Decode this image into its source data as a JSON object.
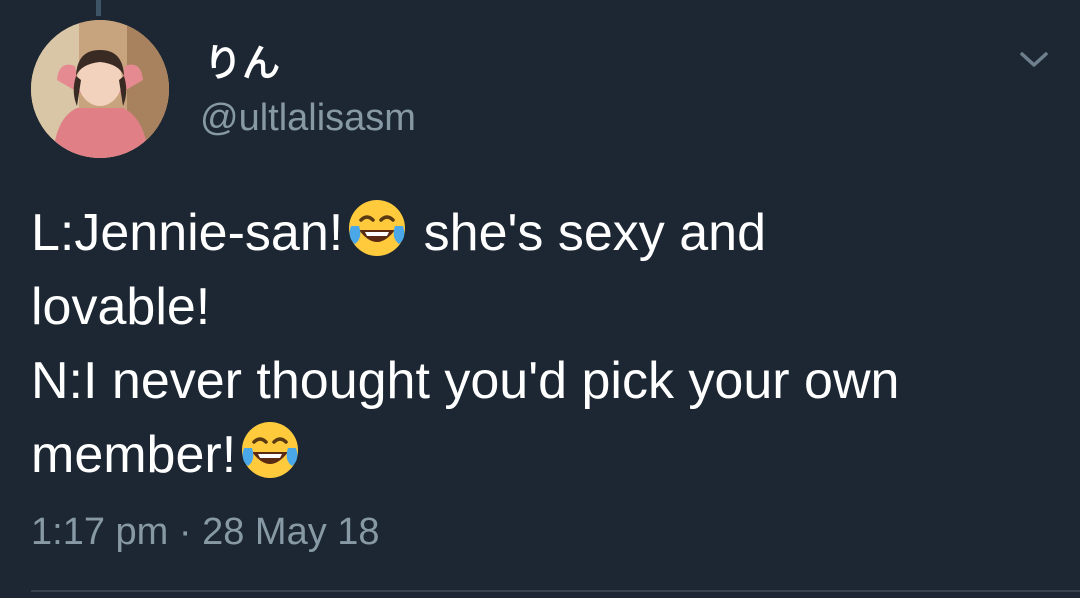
{
  "tweet": {
    "author": {
      "display_name": "りん",
      "handle": "@ultlalisasm"
    },
    "text_lines": [
      {
        "text": "L:Jennie-san!",
        "emoji": "face-with-tears-of-joy",
        "after": " she's sexy and"
      },
      {
        "text": "lovable!"
      },
      {
        "text": "N:I never thought you'd pick your own"
      },
      {
        "text": "member!",
        "emoji": "face-with-tears-of-joy"
      }
    ],
    "time": "1:17 pm",
    "separator": "·",
    "date": "28 May 18"
  },
  "icons": {
    "menu": "chevron-down-icon",
    "emoji": "face-with-tears-of-joy"
  },
  "colors": {
    "background": "#1c2733",
    "text": "#ffffff",
    "secondary_text": "#8899a6",
    "divider": "#38444d"
  }
}
